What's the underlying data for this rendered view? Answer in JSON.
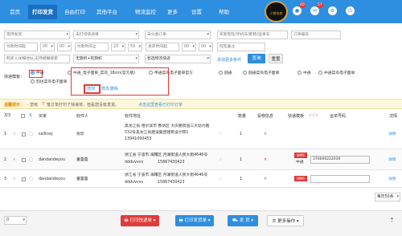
{
  "nav": {
    "items": [
      "首页",
      "打印发货",
      "自由打印",
      "其他平台",
      "物流监控",
      "更多",
      "设置",
      "帮助"
    ],
    "logo_text": "小猪电商",
    "badges": [
      "40",
      "57"
    ]
  },
  "filters": {
    "row1": [
      "等待发货",
      "未打印快递单",
      "未分类订单",
      "买家旺旺/手机号/昵称/运单号",
      "订单编号"
    ],
    "row2": [
      "付款时间起",
      "00",
      "00",
      "付款时间止",
      "23",
      "59",
      "发货时间起",
      "00",
      "00",
      "旺旺备注"
    ],
    "row3_placeholder": "购买人详细地址,支持模糊搜索",
    "row3_select1": "无旗帜+有旗帜",
    "row3_select2": "智选物流快递",
    "add_condition": "添加更多条件",
    "search_btn": "查询",
    "reset_btn": "重置"
  },
  "template": {
    "label": "快递模板：",
    "options": [
      "申通",
      "中通_电子面单_菜鸟_18cm(官方版)",
      "申通菜鸟电子面单官方",
      "圆通",
      "圆通菜鸟电子面单",
      "中通",
      "中通菜鸟电子面单",
      "韵达菜鸟电子面单"
    ],
    "add": "增加",
    "modify": "修改",
    "delete": "删除"
  },
  "warning": {
    "title": "温馨提示：",
    "prefix": "· 您有",
    "count": "7",
    "middle": "笔订单打印了快递单，但是您没有发货。",
    "link": "点击这里查看已打印订单"
  },
  "pagination": {
    "label": "3/3",
    "per_page": "每页50条"
  },
  "table": {
    "headers": [
      "买家",
      "收件人",
      "收件地址",
      "数量",
      "投物信息",
      "快递模板",
      "运单号码",
      "详情"
    ],
    "rows": [
      {
        "num": "1",
        "buyer": "sallicey",
        "recipient": "张欣",
        "addr1": "黑龙江省 哈尔滨市 香坊区 大庆路街道三大动力路",
        "addr2": "532号黑龙江省建设集团建筑设计院1",
        "phone": "13941090453",
        "qty": "1",
        "tpl": "",
        "tracking": "",
        "detail": "详情"
      },
      {
        "num": "2",
        "buyer": "dandandeyou",
        "recipient": "董蕾蕾",
        "addr1": "浙江省 宁波市 海曙区 月湖街道人民大街4646号",
        "addr2": "dddvvvvv",
        "phone": "15867430423",
        "qty": "1",
        "tpl": "WMS",
        "tpl_sub": "中通",
        "tracking": "370000222030",
        "detail": "详情"
      },
      {
        "num": "3",
        "buyer": "dandandeyou",
        "recipient": "董蕾蕾",
        "addr1": "浙江省 宁波市 海曙区 月湖街道人民大街4646号",
        "addr2": "dddvvvvv",
        "phone": "15867430423",
        "qty": "1",
        "tpl": "WMS",
        "tracking": "",
        "detail": "详情"
      }
    ]
  },
  "bottom": {
    "page_select": "0",
    "print_express": "打印快递单",
    "print_invoice": "打印发货单",
    "ship": "发 货",
    "more": "更多操作"
  },
  "colors": {
    "nav": "#2e8ee0",
    "print_red": "#e03b3b",
    "ship_blue": "#2e8ee0"
  }
}
